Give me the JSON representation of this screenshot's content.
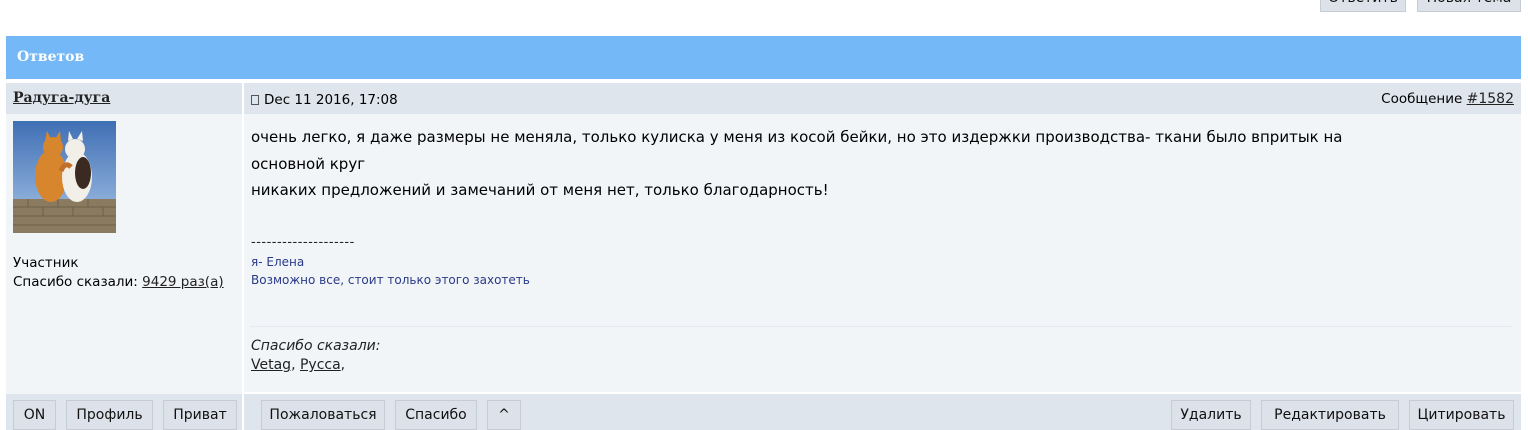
{
  "top_actions": {
    "reply_label": "Ответить",
    "new_topic_label": "Новая тема"
  },
  "header": {
    "label": "Ответов"
  },
  "author": {
    "name": "Радуга-дуга",
    "rank": "Участник",
    "thanks_prefix": "Спасибо сказали: ",
    "thanks_link": "9429 раз(а)"
  },
  "post": {
    "date": "Dec 11 2016, 17:08",
    "message_prefix": "Сообщение ",
    "message_number": "#1582",
    "lines": [
      "очень легко, я даже размеры не меняла, только кулиска у меня из косой бейки, но это издержки производства- ткани было впритык на",
      "основной круг",
      "никаких предложений и замечаний от меня нет, только благодарность!"
    ],
    "signature_separator": "--------------------",
    "signature_name": "я- Елена",
    "signature_motto": "Возможно все, стоит только этого захотеть",
    "thanked_title": "Спасибо сказали:",
    "thanked_users": [
      "Vetag",
      "Русса"
    ]
  },
  "bottom_left_buttons": {
    "online": "ON",
    "profile": "Профиль",
    "private": "Приват"
  },
  "bottom_right_buttons": {
    "report": "Пожаловаться",
    "thanks": "Спасибо",
    "up": "^",
    "delete": "Удалить",
    "edit": "Редактировать",
    "quote": "Цитировать"
  },
  "colors": {
    "header_bg": "#74b8f7",
    "bar_bg": "#dfe5ed",
    "body_bg": "#f2f5f8",
    "signature_text": "#2a3a88"
  }
}
